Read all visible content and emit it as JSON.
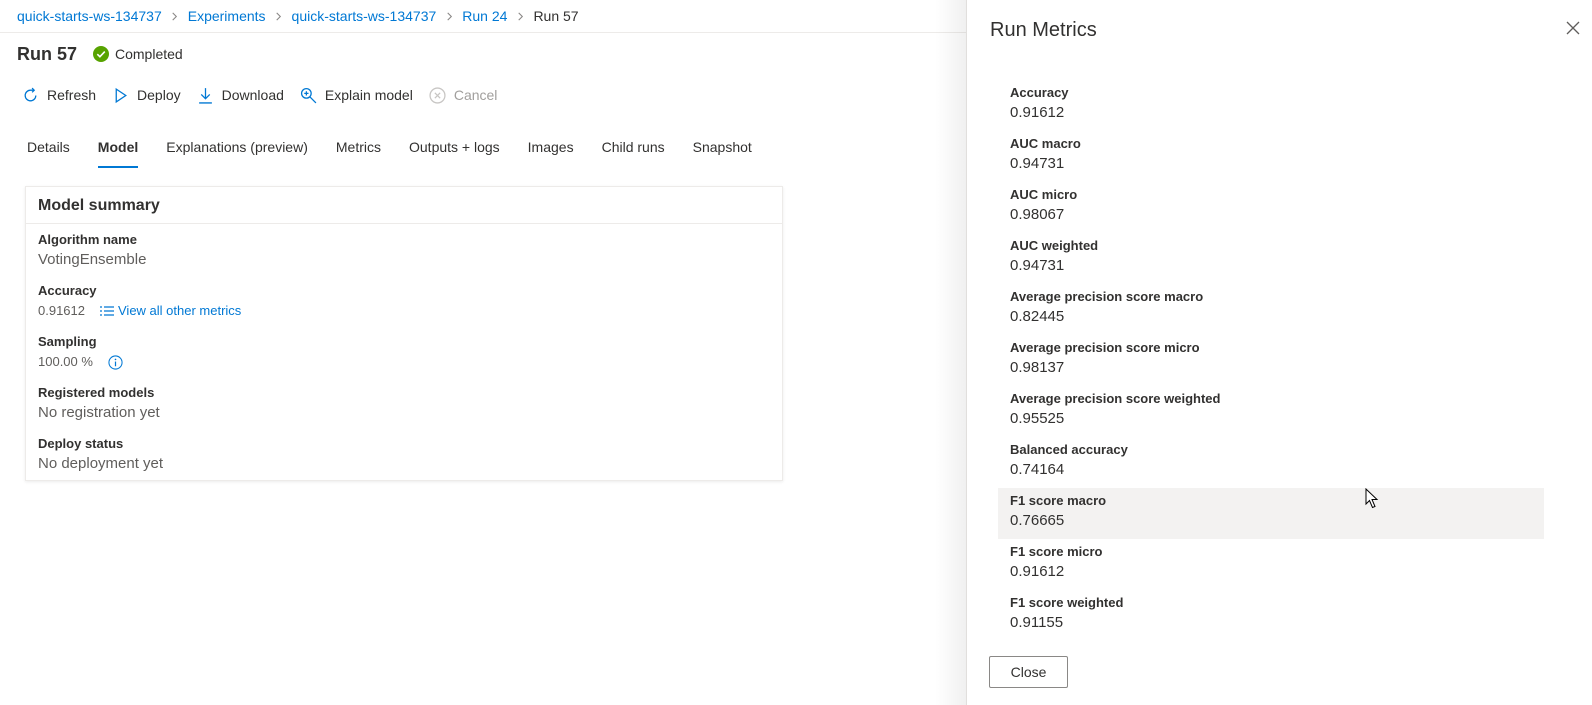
{
  "breadcrumb": {
    "items": [
      "quick-starts-ws-134737",
      "Experiments",
      "quick-starts-ws-134737",
      "Run 24",
      "Run 57"
    ]
  },
  "header": {
    "title": "Run 57",
    "status": "Completed",
    "status_color": "#57a300"
  },
  "toolbar": {
    "refresh": "Refresh",
    "deploy": "Deploy",
    "download": "Download",
    "explain": "Explain model",
    "cancel": "Cancel"
  },
  "tabs": [
    "Details",
    "Model",
    "Explanations (preview)",
    "Metrics",
    "Outputs + logs",
    "Images",
    "Child runs",
    "Snapshot"
  ],
  "active_tab": "Model",
  "summary": {
    "title": "Model summary",
    "algorithm_label": "Algorithm name",
    "algorithm_value": "VotingEnsemble",
    "accuracy_label": "Accuracy",
    "accuracy_value": "0.91612",
    "view_metrics_link": "View all other metrics",
    "sampling_label": "Sampling",
    "sampling_value": "100.00 %",
    "registered_label": "Registered models",
    "registered_value": "No registration yet",
    "deploy_label": "Deploy status",
    "deploy_value": "No deployment yet"
  },
  "panel": {
    "title": "Run Metrics",
    "close_label": "Close",
    "metrics": [
      {
        "name": "Accuracy",
        "value": "0.91612"
      },
      {
        "name": "AUC macro",
        "value": "0.94731"
      },
      {
        "name": "AUC micro",
        "value": "0.98067"
      },
      {
        "name": "AUC weighted",
        "value": "0.94731"
      },
      {
        "name": "Average precision score macro",
        "value": "0.82445"
      },
      {
        "name": "Average precision score micro",
        "value": "0.98137"
      },
      {
        "name": "Average precision score weighted",
        "value": "0.95525"
      },
      {
        "name": "Balanced accuracy",
        "value": "0.74164"
      },
      {
        "name": "F1 score macro",
        "value": "0.76665"
      },
      {
        "name": "F1 score micro",
        "value": "0.91612"
      },
      {
        "name": "F1 score weighted",
        "value": "0.91155"
      }
    ]
  },
  "colors": {
    "accent": "#0078d4",
    "hover_row": "#f3f2f1"
  }
}
